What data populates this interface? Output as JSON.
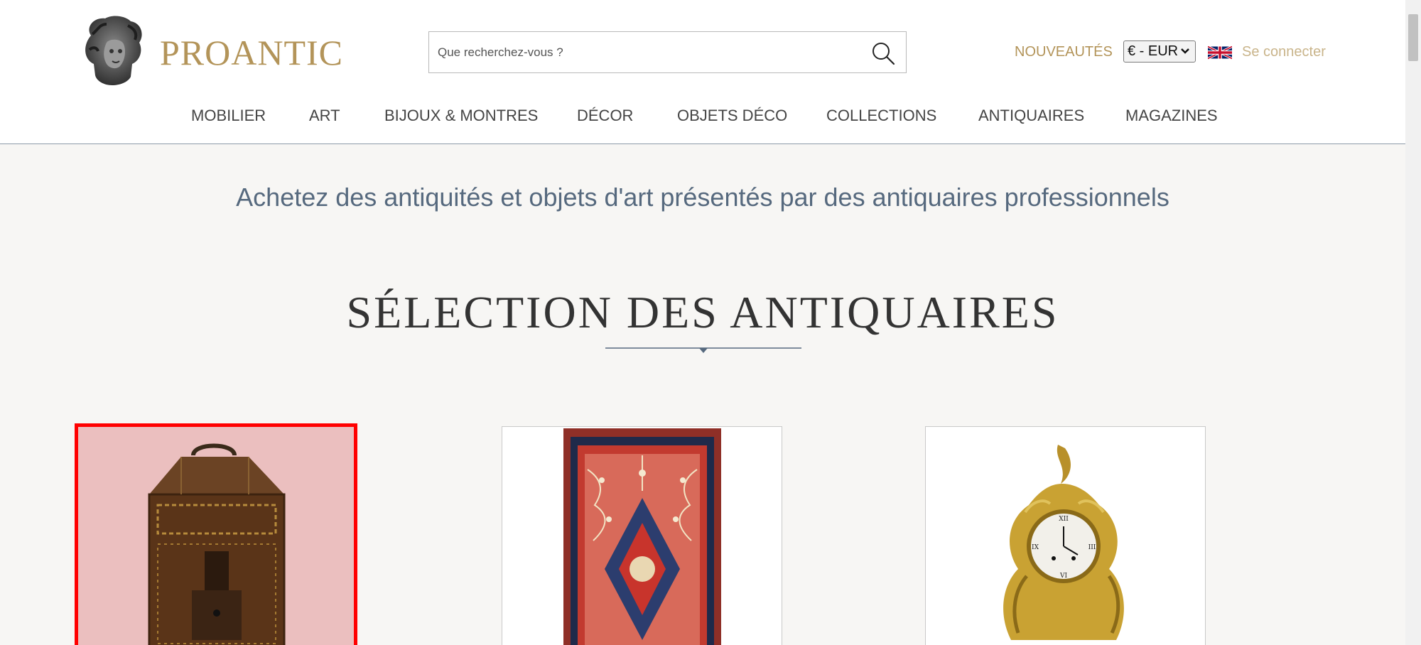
{
  "brand": {
    "name": "PROANTIC"
  },
  "search": {
    "placeholder": "Que recherchez-vous ?"
  },
  "header": {
    "new_label": "NOUVEAUTÉS",
    "currency": "€ - EUR",
    "signin_label": "Se connecter"
  },
  "nav": {
    "items": [
      {
        "label": "MOBILIER"
      },
      {
        "label": "ART"
      },
      {
        "label": "BIJOUX & MONTRES"
      },
      {
        "label": "DÉCOR"
      },
      {
        "label": "OBJETS DÉCO"
      },
      {
        "label": "COLLECTIONS"
      },
      {
        "label": "ANTIQUAIRES"
      },
      {
        "label": "MAGAZINES"
      }
    ]
  },
  "main": {
    "tagline": "Achetez des antiquités et objets d'art présentés par des antiquaires professionnels",
    "section_title": "SÉLECTION DES ANTIQUAIRES"
  },
  "colors": {
    "brand_gold": "#b39459",
    "tagline_blue": "#56697e",
    "highlight_red": "#ff0000"
  }
}
